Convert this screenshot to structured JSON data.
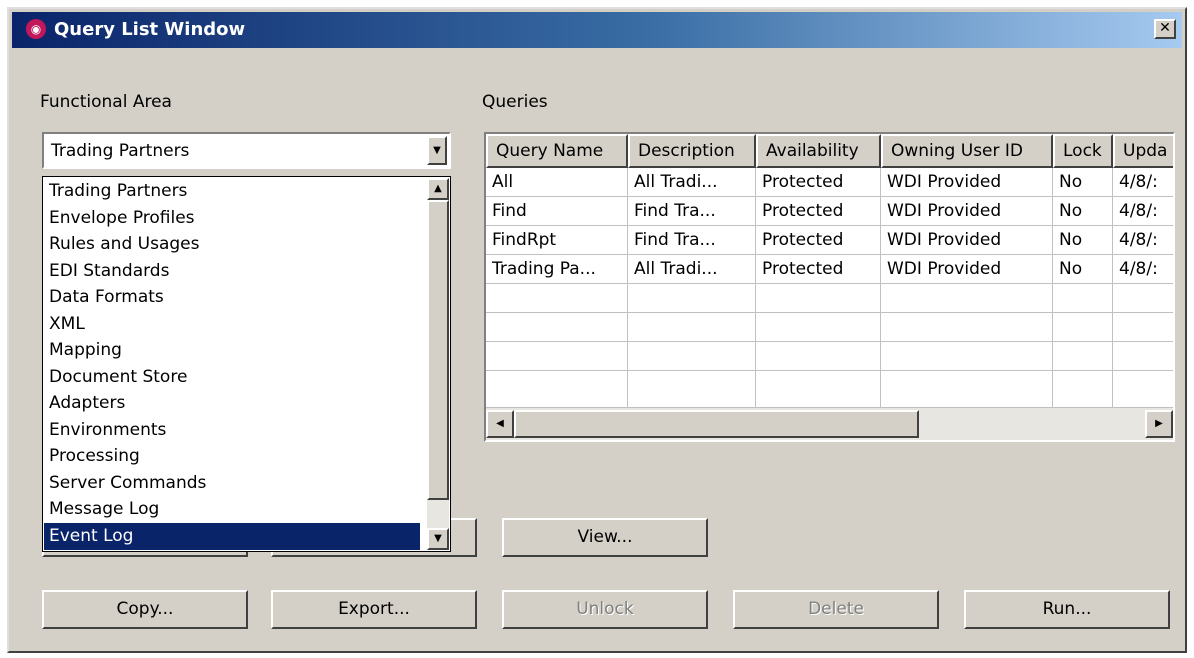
{
  "window": {
    "title": "Query List Window",
    "close_glyph": "✕"
  },
  "functional_area": {
    "label": "Functional Area",
    "selected": "Trading Partners",
    "options": [
      "Trading Partners",
      "Envelope Profiles",
      "Rules and Usages",
      "EDI Standards",
      "Data Formats",
      "XML",
      "Mapping",
      "Document Store",
      "Adapters",
      "Environments",
      "Processing",
      "Server Commands",
      "Message Log",
      "Event Log"
    ],
    "highlighted": "Event Log"
  },
  "queries": {
    "label": "Queries",
    "columns": [
      "Query Name",
      "Description",
      "Availability",
      "Owning User ID",
      "Lock",
      "Upda"
    ],
    "rows": [
      [
        "All",
        "All Tradi...",
        "Protected",
        "WDI Provided",
        "No",
        "4/8/:"
      ],
      [
        "Find",
        "Find Tra...",
        "Protected",
        "WDI Provided",
        "No",
        "4/8/:"
      ],
      [
        "FindRpt",
        "Find Tra...",
        "Protected",
        "WDI Provided",
        "No",
        "4/8/:"
      ],
      [
        "Trading Pa...",
        "All Tradi...",
        "Protected",
        "WDI Provided",
        "No",
        "4/8/:"
      ]
    ]
  },
  "buttons": {
    "view": "View...",
    "copy": "Copy...",
    "export": "Export...",
    "unlock": "Unlock",
    "delete": "Delete",
    "run": "Run..."
  },
  "icons": [
    "app-icon",
    "close-icon",
    "dropdown-arrow-icon",
    "scroll-up-icon",
    "scroll-down-icon",
    "scroll-left-icon",
    "scroll-right-icon"
  ]
}
